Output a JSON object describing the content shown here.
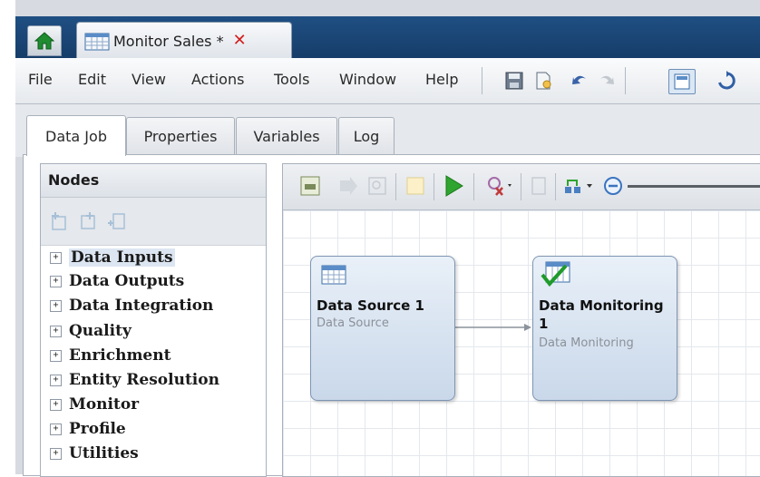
{
  "window": {
    "tab_title": "Monitor Sales *"
  },
  "menu": [
    "File",
    "Edit",
    "View",
    "Actions",
    "Tools",
    "Window",
    "Help"
  ],
  "tabs": [
    "Data Job",
    "Properties",
    "Variables",
    "Log"
  ],
  "nodes_panel": {
    "header": "Nodes",
    "items": [
      "Data Inputs",
      "Data Outputs",
      "Data Integration",
      "Quality",
      "Enrichment",
      "Entity Resolution",
      "Monitor",
      "Profile",
      "Utilities"
    ]
  },
  "canvas": {
    "nodes": [
      {
        "title": "Data Source 1",
        "type": "Data Source"
      },
      {
        "title": "Data Monitoring 1",
        "type": "Data Monitoring"
      }
    ]
  },
  "icons": {
    "home": "home-icon",
    "close": "close-icon",
    "save": "save-icon",
    "run": "run-icon"
  },
  "colors": {
    "titlebar": "#1f4f83",
    "accent": "#c9d8ea",
    "close": "#d21f1f",
    "run": "#2fa52f"
  }
}
